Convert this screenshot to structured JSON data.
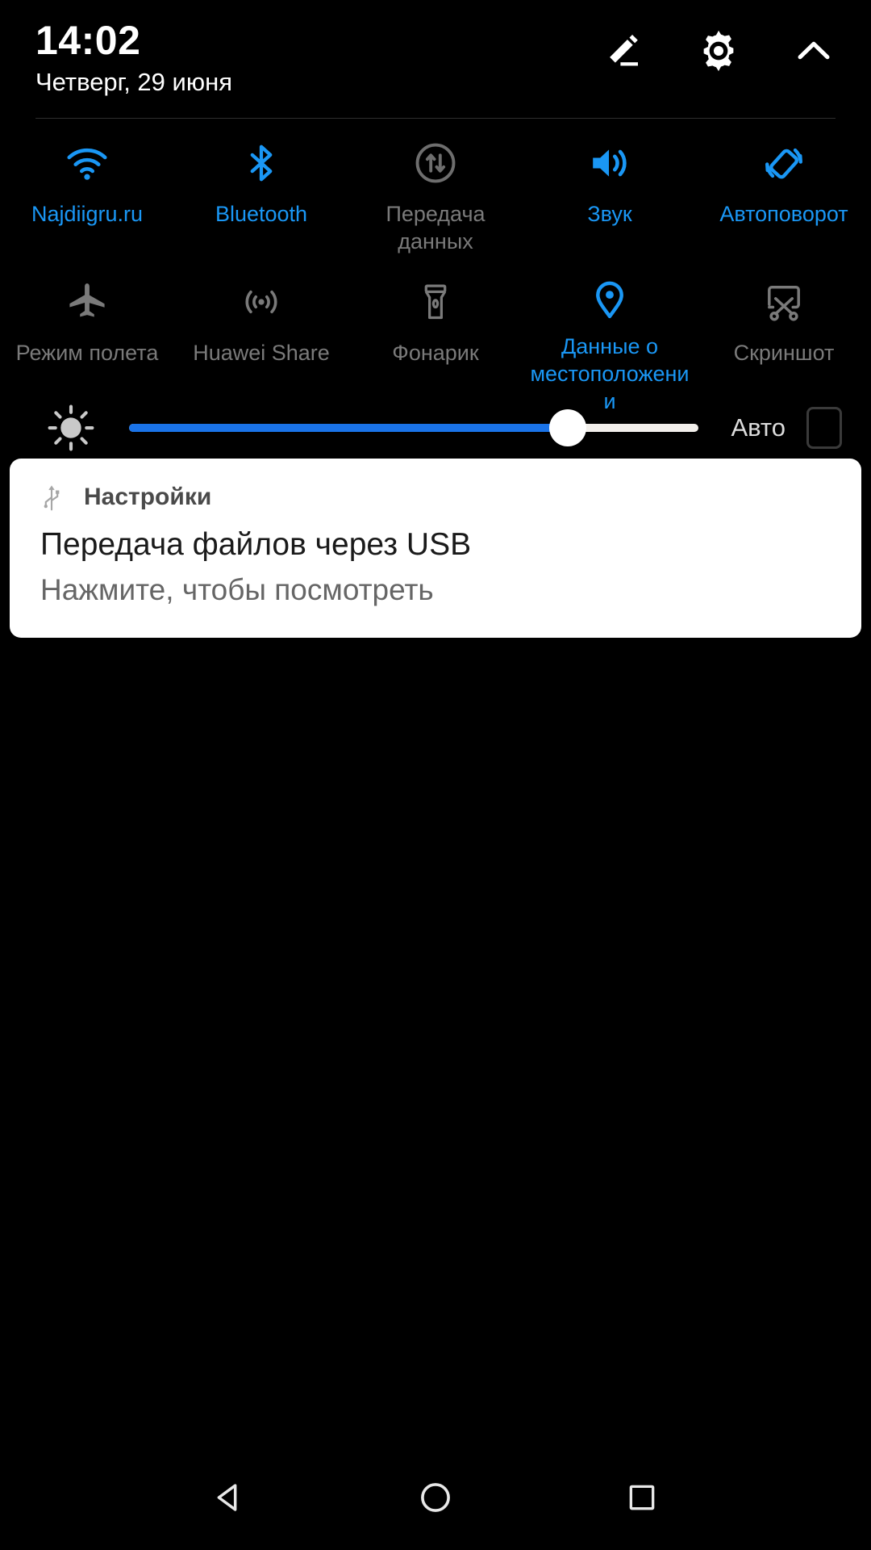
{
  "statusbar": {
    "time": "14:02",
    "date": "Четверг, 29 июня",
    "actions": [
      {
        "name": "edit-icon",
        "label": "Изменить"
      },
      {
        "name": "gear-icon",
        "label": "Настройки"
      },
      {
        "name": "chevron-up-icon",
        "label": "Свернуть"
      }
    ]
  },
  "tiles": {
    "row1": [
      {
        "label": "Najdiigru.ru",
        "icon": "wifi-icon",
        "state": "on"
      },
      {
        "label": "Bluetooth",
        "icon": "bluetooth-icon",
        "state": "on"
      },
      {
        "label": "Передача данных",
        "icon": "mobile-data-icon",
        "state": "off"
      },
      {
        "label": "Звук",
        "icon": "sound-icon",
        "state": "on"
      },
      {
        "label": "Автоповорот",
        "icon": "auto-rotate-icon",
        "state": "on"
      }
    ],
    "row2": [
      {
        "label": "Режим полета",
        "icon": "airplane-icon",
        "state": "off"
      },
      {
        "label": "Huawei Share",
        "icon": "huawei-share-icon",
        "state": "off"
      },
      {
        "label": "Фонарик",
        "icon": "flashlight-icon",
        "state": "off"
      },
      {
        "label": "Данные о местоположении",
        "icon": "location-pin-icon",
        "state": "on"
      },
      {
        "label": "Скриншот",
        "icon": "screenshot-icon",
        "state": "off"
      }
    ]
  },
  "brightness": {
    "icon": "brightness-sun-icon",
    "value_percent": 77,
    "auto_label": "Авто",
    "auto_checked": false
  },
  "notification": {
    "app_icon": "usb-icon",
    "app_name": "Настройки",
    "title": "Передача файлов через USB",
    "subtitle": "Нажмите, чтобы посмотреть"
  },
  "navbar": {
    "back": "Назад",
    "home": "Главный экран",
    "recents": "Последние приложения"
  },
  "colors": {
    "accent": "#1a97f5",
    "slider_fill": "#1a73e8",
    "inactive": "#7a7a7a",
    "background": "#000000",
    "card": "#ffffff"
  }
}
